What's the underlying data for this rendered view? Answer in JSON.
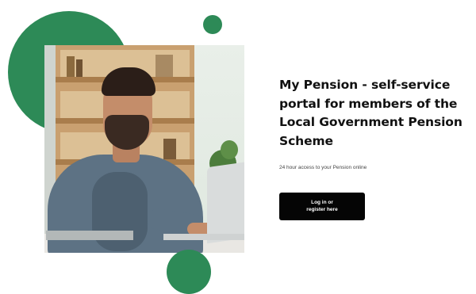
{
  "hero": {
    "title": "My Pension - self-service portal for members of the Local Government Pension Scheme",
    "subtitle": "24 hour access to your Pension online",
    "cta_label": "Log in or register here"
  },
  "colors": {
    "accent_green": "#2d8a57",
    "button_bg": "#050505",
    "button_text": "#ffffff",
    "title_text": "#111111"
  }
}
